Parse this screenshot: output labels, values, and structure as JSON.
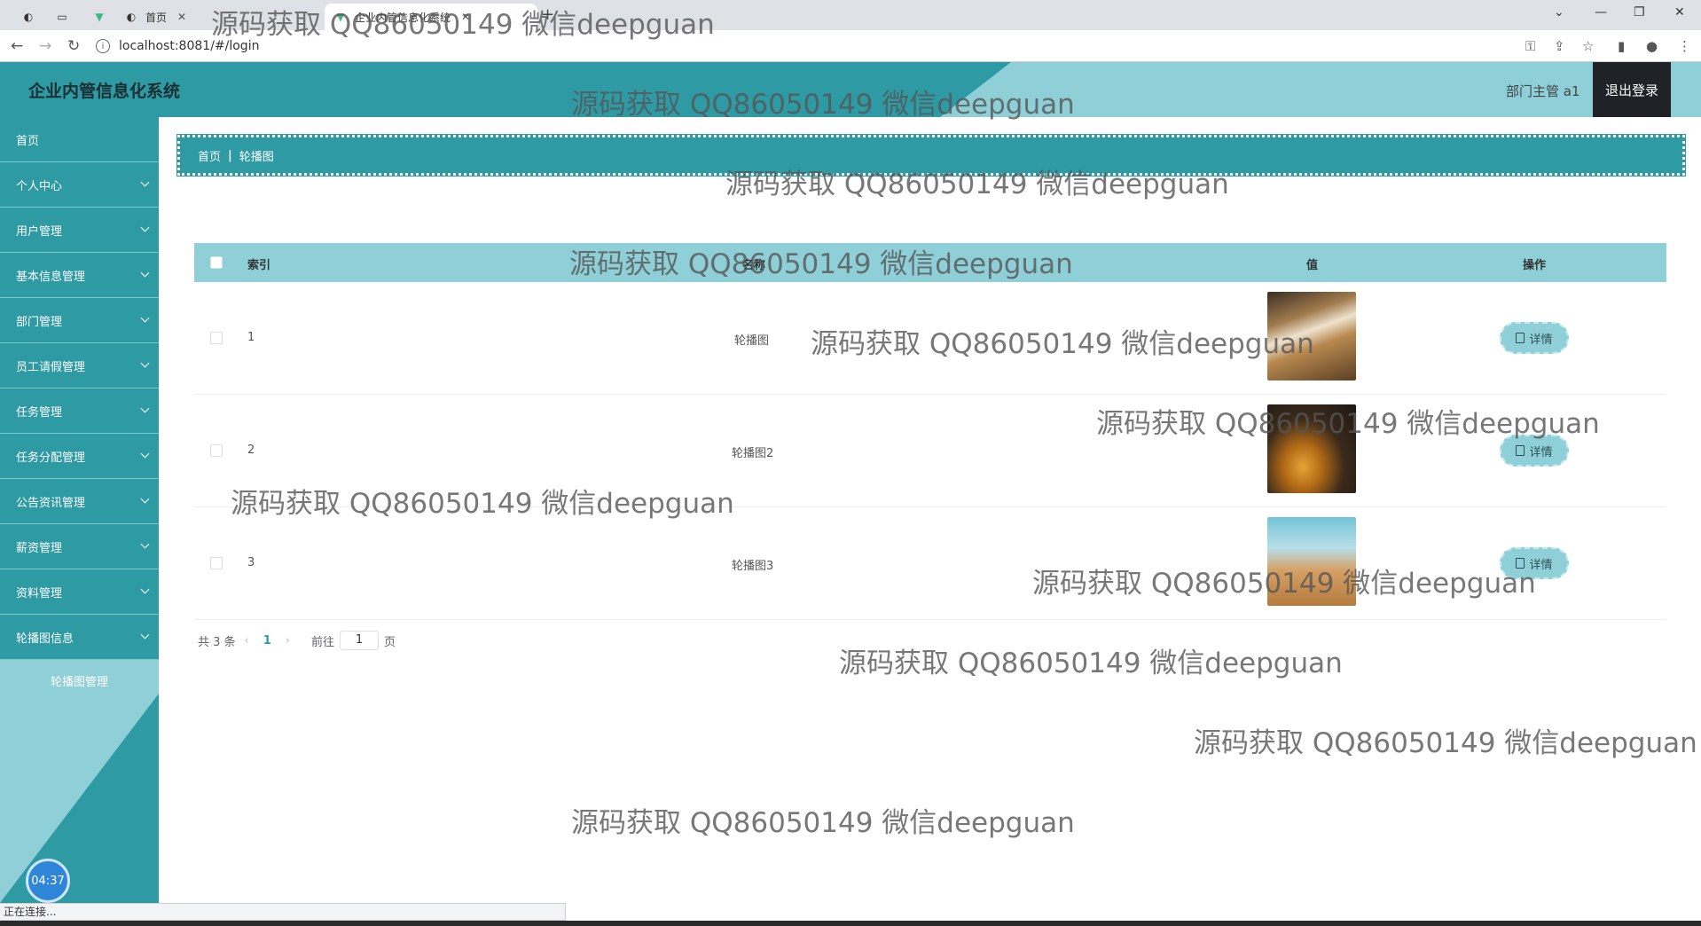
{
  "browser": {
    "tabs": [
      {
        "label": ""
      },
      {
        "label": "首页"
      },
      {
        "label": "企业内管信息化系统"
      }
    ],
    "url": "localhost:8081/#/login",
    "status_text": "正在连接..."
  },
  "header": {
    "title": "企业内管信息化系统",
    "user": "部门主管 a1",
    "logout": "退出登录"
  },
  "sidebar": {
    "items": [
      {
        "label": "首页"
      },
      {
        "label": "个人中心"
      },
      {
        "label": "用户管理"
      },
      {
        "label": "基本信息管理"
      },
      {
        "label": "部门管理"
      },
      {
        "label": "员工请假管理"
      },
      {
        "label": "任务管理"
      },
      {
        "label": "任务分配管理"
      },
      {
        "label": "公告资讯管理"
      },
      {
        "label": "薪资管理"
      },
      {
        "label": "资料管理"
      },
      {
        "label": "轮播图信息"
      }
    ],
    "sub_item": "轮播图管理",
    "clock": "04:37"
  },
  "breadcrumb": {
    "home": "首页",
    "current": "轮播图"
  },
  "table": {
    "headers": {
      "index": "索引",
      "name": "名称",
      "value": "值",
      "action": "操作"
    },
    "rows": [
      {
        "index": "1",
        "name": "轮播图",
        "action": "详情"
      },
      {
        "index": "2",
        "name": "轮播图2",
        "action": "详情"
      },
      {
        "index": "3",
        "name": "轮播图3",
        "action": "详情"
      }
    ]
  },
  "pagination": {
    "total": "共 3 条",
    "current": "1",
    "goto": "前往",
    "goto_value": "1",
    "page_unit": "页"
  },
  "watermark": "源码获取 QQ86050149 微信deepguan",
  "colors": {
    "primary": "#2e9aa3",
    "light": "#8fd0d8",
    "logout_bg": "#1f2327"
  }
}
